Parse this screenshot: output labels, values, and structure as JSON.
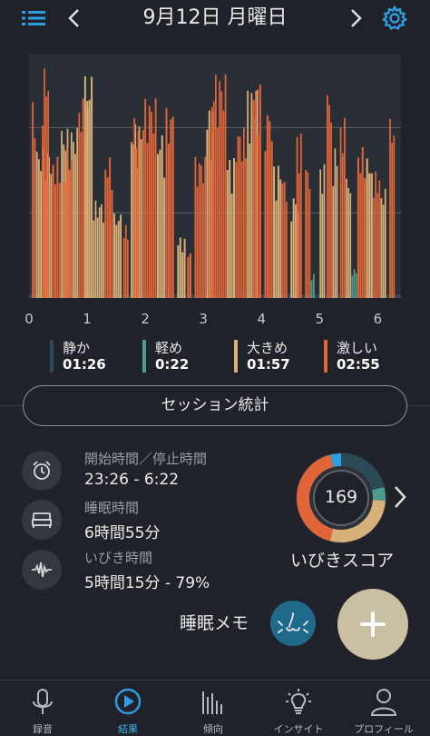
{
  "header": {
    "title": "9月12日 月曜日",
    "menu_icon": "list-icon",
    "prev_icon": "chevron-left-icon",
    "next_icon": "chevron-right-icon",
    "settings_icon": "gear-icon",
    "accent_color": "#2e9fe0"
  },
  "chart_data": {
    "type": "bar",
    "x_ticks": [
      "0",
      "1",
      "2",
      "3",
      "4",
      "5",
      "6"
    ],
    "xlim": [
      0,
      6.4
    ],
    "ylim": [
      0,
      1
    ],
    "ygrid": [
      0.35,
      0.7
    ],
    "colors": {
      "quiet": "#2b4a57",
      "light": "#4e9a8c",
      "loud": "#d8b07a",
      "epic": "#e0663a"
    },
    "segments": [
      {
        "start": 0.05,
        "end": 0.12,
        "level": "epic",
        "height": 0.84
      },
      {
        "start": 0.12,
        "end": 0.4,
        "level": "loud",
        "height": 0.62
      },
      {
        "start": 0.22,
        "end": 0.35,
        "level": "epic",
        "height": 0.95
      },
      {
        "start": 0.4,
        "end": 0.55,
        "level": "epic",
        "height": 0.58
      },
      {
        "start": 0.55,
        "end": 0.85,
        "level": "loud",
        "height": 0.7
      },
      {
        "start": 0.6,
        "end": 0.75,
        "level": "epic",
        "height": 0.62
      },
      {
        "start": 0.85,
        "end": 1.05,
        "level": "epic",
        "height": 0.82
      },
      {
        "start": 0.95,
        "end": 1.1,
        "level": "loud",
        "height": 0.92
      },
      {
        "start": 1.1,
        "end": 1.3,
        "level": "loud",
        "height": 0.4
      },
      {
        "start": 1.3,
        "end": 1.45,
        "level": "epic",
        "height": 0.58
      },
      {
        "start": 1.45,
        "end": 1.6,
        "level": "loud",
        "height": 0.35
      },
      {
        "start": 1.62,
        "end": 1.72,
        "level": "epic",
        "height": 0.3
      },
      {
        "start": 1.75,
        "end": 1.95,
        "level": "loud",
        "height": 0.72
      },
      {
        "start": 1.8,
        "end": 1.9,
        "level": "epic",
        "height": 0.74
      },
      {
        "start": 1.95,
        "end": 2.2,
        "level": "epic",
        "height": 0.82
      },
      {
        "start": 2.2,
        "end": 2.35,
        "level": "loud",
        "height": 0.68
      },
      {
        "start": 2.35,
        "end": 2.5,
        "level": "epic",
        "height": 0.78
      },
      {
        "start": 2.55,
        "end": 2.7,
        "level": "loud",
        "height": 0.25
      },
      {
        "start": 2.72,
        "end": 2.8,
        "level": "epic",
        "height": 0.2
      },
      {
        "start": 2.85,
        "end": 3.05,
        "level": "epic",
        "height": 0.58
      },
      {
        "start": 3.05,
        "end": 3.2,
        "level": "loud",
        "height": 0.78
      },
      {
        "start": 3.1,
        "end": 3.2,
        "level": "epic",
        "height": 0.84
      },
      {
        "start": 3.2,
        "end": 3.4,
        "level": "epic",
        "height": 0.92
      },
      {
        "start": 3.4,
        "end": 3.55,
        "level": "loud",
        "height": 0.58
      },
      {
        "start": 3.55,
        "end": 3.75,
        "level": "epic",
        "height": 0.7
      },
      {
        "start": 3.75,
        "end": 3.95,
        "level": "loud",
        "height": 0.86
      },
      {
        "start": 3.85,
        "end": 4.0,
        "level": "epic",
        "height": 0.88
      },
      {
        "start": 4.05,
        "end": 4.2,
        "level": "epic",
        "height": 0.78
      },
      {
        "start": 4.2,
        "end": 4.35,
        "level": "loud",
        "height": 0.55
      },
      {
        "start": 4.35,
        "end": 4.45,
        "level": "epic",
        "height": 0.5
      },
      {
        "start": 4.5,
        "end": 4.65,
        "level": "loud",
        "height": 0.42
      },
      {
        "start": 4.6,
        "end": 4.7,
        "level": "epic",
        "height": 0.68
      },
      {
        "start": 4.75,
        "end": 4.85,
        "level": "epic",
        "height": 0.55
      },
      {
        "start": 4.85,
        "end": 4.92,
        "level": "light",
        "height": 0.1
      },
      {
        "start": 5.0,
        "end": 5.1,
        "level": "loud",
        "height": 0.55
      },
      {
        "start": 5.12,
        "end": 5.22,
        "level": "epic",
        "height": 0.86
      },
      {
        "start": 5.22,
        "end": 5.32,
        "level": "loud",
        "height": 0.62
      },
      {
        "start": 5.35,
        "end": 5.45,
        "level": "epic",
        "height": 0.74
      },
      {
        "start": 5.45,
        "end": 5.55,
        "level": "loud",
        "height": 0.5
      },
      {
        "start": 5.55,
        "end": 5.65,
        "level": "light",
        "height": 0.12
      },
      {
        "start": 5.65,
        "end": 5.8,
        "level": "epic",
        "height": 0.62
      },
      {
        "start": 5.8,
        "end": 5.92,
        "level": "loud",
        "height": 0.58
      },
      {
        "start": 5.92,
        "end": 6.05,
        "level": "epic",
        "height": 0.52
      },
      {
        "start": 6.05,
        "end": 6.15,
        "level": "loud",
        "height": 0.45
      },
      {
        "start": 6.2,
        "end": 6.3,
        "level": "epic",
        "height": 0.74
      }
    ]
  },
  "legend": [
    {
      "name": "静か",
      "time": "01:26",
      "color": "#2b4a57"
    },
    {
      "name": "軽め",
      "time": "0:22",
      "color": "#4e9a8c"
    },
    {
      "name": "大きめ",
      "time": "01:57",
      "color": "#d8b07a"
    },
    {
      "name": "激しい",
      "time": "02:55",
      "color": "#e0663a"
    }
  ],
  "session": {
    "label": "セッション統計"
  },
  "stats": [
    {
      "label": "開始時間／停止時間",
      "value": "23:26 - 6:22",
      "icon": "alarm-clock-icon"
    },
    {
      "label": "睡眠時間",
      "value": "6時間55分",
      "icon": "bed-icon"
    },
    {
      "label": "いびき時間",
      "value": "5時間15分 - 79%",
      "icon": "waveform-icon"
    }
  ],
  "score": {
    "value": "169",
    "label": "いびきスコア",
    "ring": [
      {
        "level": "quiet",
        "fraction": 0.21,
        "color": "#2b4a57"
      },
      {
        "level": "light",
        "fraction": 0.05,
        "color": "#4e9a8c"
      },
      {
        "level": "loud",
        "fraction": 0.28,
        "color": "#d8b07a"
      },
      {
        "level": "epic",
        "fraction": 0.42,
        "color": "#e0663a"
      },
      {
        "level": "marker",
        "fraction": 0.04,
        "color": "#2e9fe0"
      }
    ]
  },
  "memo": {
    "label": "睡眠メモ",
    "icon": "nose-icon",
    "add_icon": "plus-icon"
  },
  "nav": [
    {
      "label": "録音",
      "icon": "microphone-icon",
      "active": false
    },
    {
      "label": "結果",
      "icon": "play-icon",
      "active": true
    },
    {
      "label": "傾向",
      "icon": "bar-chart-icon",
      "active": false
    },
    {
      "label": "インサイト",
      "icon": "lightbulb-icon",
      "active": false
    },
    {
      "label": "プロフィール",
      "icon": "person-icon",
      "active": false
    }
  ]
}
